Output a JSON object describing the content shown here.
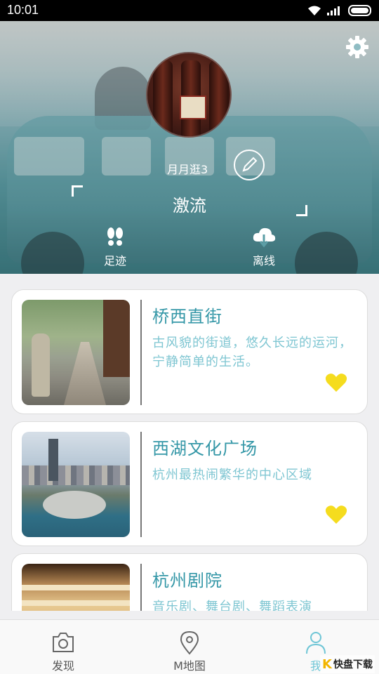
{
  "status_bar": {
    "time": "10:01"
  },
  "profile": {
    "username": "月月逛3",
    "signature": "激流",
    "actions": [
      {
        "label": "足迹",
        "icon": "footprints-icon"
      },
      {
        "label": "离线",
        "icon": "cloud-download-icon"
      }
    ]
  },
  "places": [
    {
      "title": "桥西直街",
      "description": "古风貌的街道，悠久长远的运河，宁静简单的生活。",
      "favorited": true
    },
    {
      "title": "西湖文化广场",
      "description": "杭州最热闹繁华的中心区域",
      "favorited": true
    },
    {
      "title": "杭州剧院",
      "description": "音乐剧、舞台剧、舞蹈表演",
      "favorited": true
    }
  ],
  "bottom_nav": {
    "items": [
      {
        "label": "发现",
        "icon": "camera-icon",
        "active": false
      },
      {
        "label": "M地图",
        "icon": "map-pin-icon",
        "active": false
      },
      {
        "label": "我",
        "icon": "person-icon",
        "active": true
      }
    ]
  },
  "watermark": {
    "text": "快盘下载"
  },
  "colors": {
    "accent": "#3497a7",
    "description": "#7fc6d2",
    "heart": "#f5dc1e",
    "nav_active": "#6fc6d6"
  }
}
